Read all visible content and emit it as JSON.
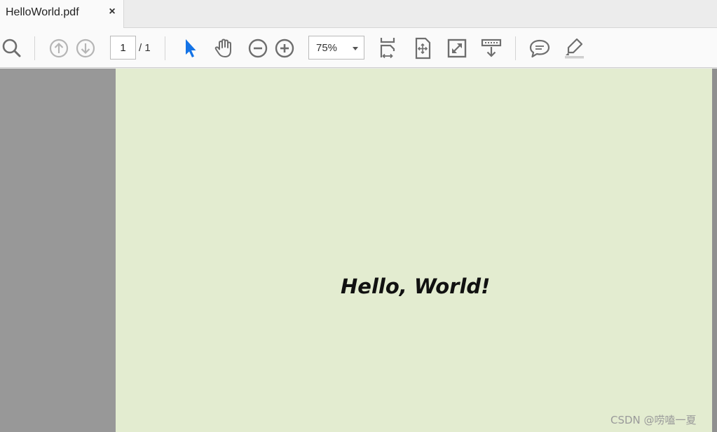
{
  "tab": {
    "title": "HelloWorld.pdf",
    "close_glyph": "×"
  },
  "toolbar": {
    "icons": {
      "search": "search-icon",
      "prev_page": "arrow-up-circle-icon",
      "next_page": "arrow-down-circle-icon",
      "select": "cursor-arrow-icon",
      "hand": "hand-icon",
      "zoom_out": "minus-circle-icon",
      "zoom_in": "plus-circle-icon",
      "fit_width": "fit-width-icon",
      "fit_page": "fit-page-icon",
      "full_screen": "full-screen-icon",
      "read_mode": "scroll-down-icon",
      "comment": "comment-icon",
      "highlight": "highlight-pen-icon"
    },
    "page_current": "1",
    "page_total": "/ 1",
    "zoom": "75%"
  },
  "document": {
    "text": "Hello, World!",
    "background": "#e3ecd0"
  },
  "watermark": "CSDN @唠嗑一夏",
  "colors": {
    "accent": "#1473e6",
    "icon": "#6e6e6e",
    "icon_disabled": "#b5b5b5"
  }
}
